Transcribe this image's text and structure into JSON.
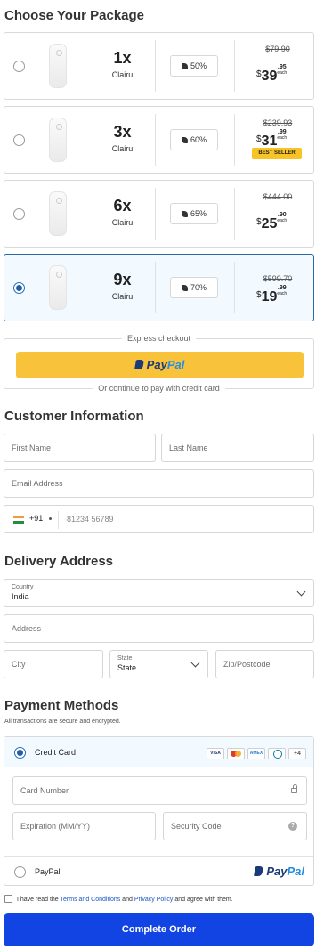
{
  "package_section": {
    "title": "Choose Your Package",
    "packages": [
      {
        "qty": "1x",
        "brand": "Clairu",
        "discount": "50%",
        "old_price": "$79.90",
        "currency": "$",
        "price_main": "39",
        "price_cents": ".95",
        "each": "each",
        "badge": "",
        "selected": false
      },
      {
        "qty": "3x",
        "brand": "Clairu",
        "discount": "60%",
        "old_price": "$239.93",
        "currency": "$",
        "price_main": "31",
        "price_cents": ".99",
        "each": "each",
        "badge": "BEST SELLER",
        "selected": false
      },
      {
        "qty": "6x",
        "brand": "Clairu",
        "discount": "65%",
        "old_price": "$444.00",
        "currency": "$",
        "price_main": "25",
        "price_cents": ".90",
        "each": "each",
        "badge": "",
        "selected": false
      },
      {
        "qty": "9x",
        "brand": "Clairu",
        "discount": "70%",
        "old_price": "$599.70",
        "currency": "$",
        "price_main": "19",
        "price_cents": ".99",
        "each": "each",
        "badge": "",
        "selected": true
      }
    ]
  },
  "express": {
    "label": "Express checkout",
    "paypal_part1": "Pay",
    "paypal_part2": "Pal",
    "continue_text": "Or continue to pay with credit card"
  },
  "customer": {
    "title": "Customer Information",
    "first_name_placeholder": "First Name",
    "last_name_placeholder": "Last Name",
    "email_placeholder": "Email Address",
    "phone_code": "+91",
    "phone_placeholder": "81234 56789"
  },
  "delivery": {
    "title": "Delivery Address",
    "country_label": "Country",
    "country_value": "India",
    "address_placeholder": "Address",
    "city_placeholder": "City",
    "state_label": "State",
    "state_value": "State",
    "zip_placeholder": "Zip/Postcode"
  },
  "payment": {
    "title": "Payment Methods",
    "subtitle": "All transactions are secure and encrypted.",
    "credit_card_label": "Credit Card",
    "cards": [
      "VISA",
      "AMEX"
    ],
    "more_cards": "+4",
    "card_number_placeholder": "Card Number",
    "expiry_placeholder": "Expiration (MM/YY)",
    "security_placeholder": "Security Code",
    "paypal_label": "PayPal",
    "paypal_part1": "Pay",
    "paypal_part2": "Pal"
  },
  "agreement": {
    "prefix": "I have read the ",
    "terms": "Terms and Conditions",
    "middle": " and ",
    "privacy": "Privacy Policy",
    "suffix": " and agree with them."
  },
  "submit_label": "Complete Order",
  "colors": {
    "primary": "#1244e4",
    "paypal_yellow": "#f8c33a",
    "badge_yellow": "#f7c325",
    "selected_border": "#2a6aa8"
  }
}
